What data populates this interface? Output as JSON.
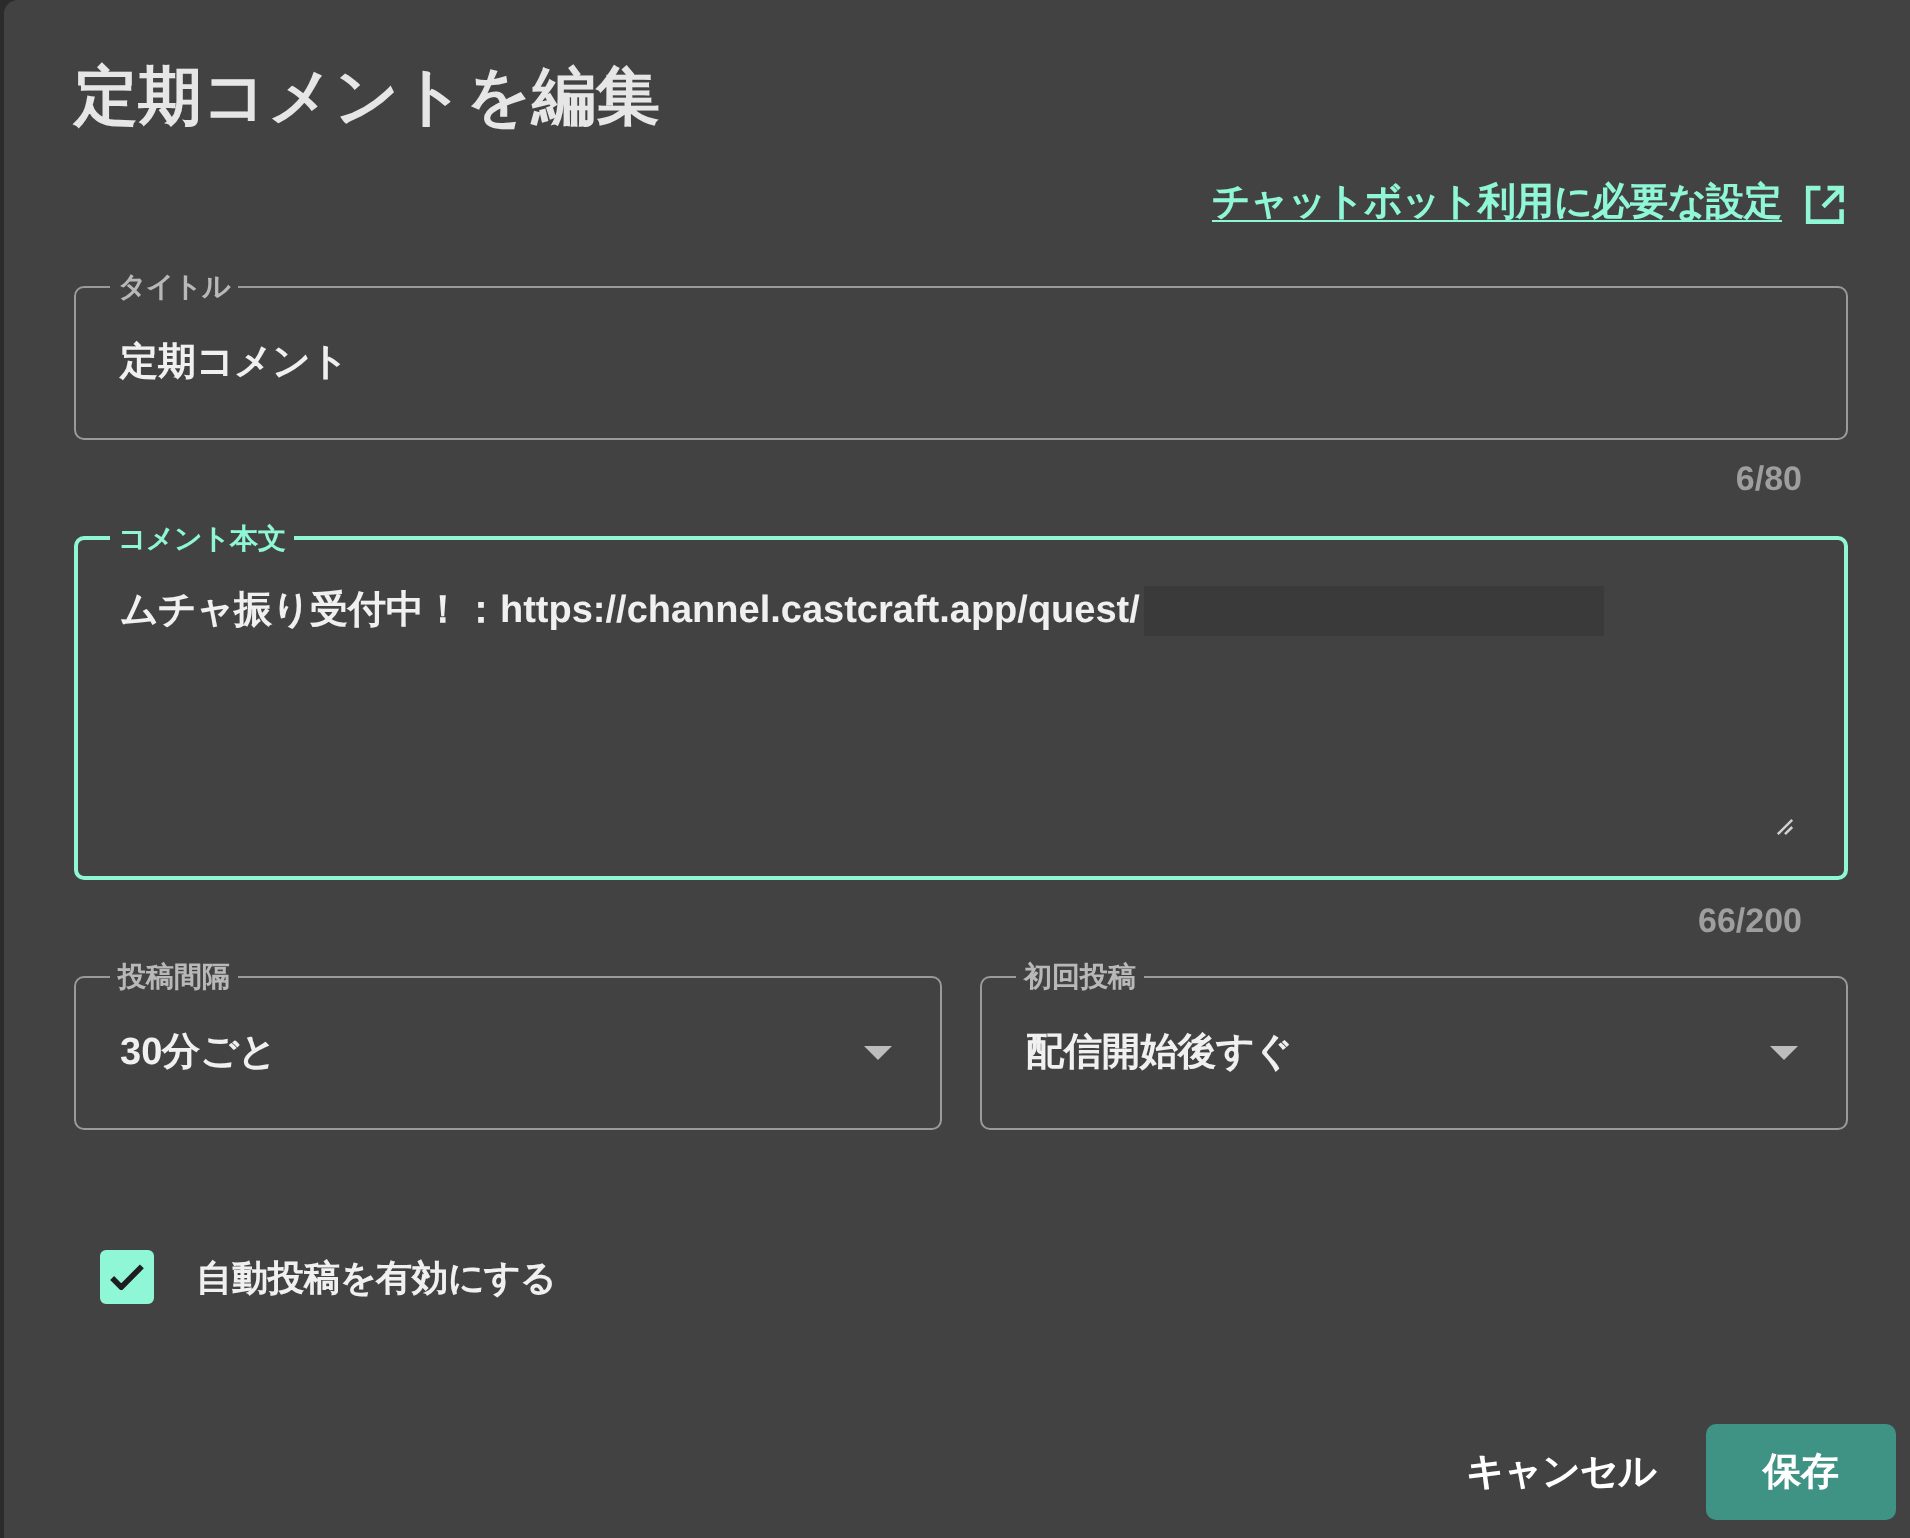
{
  "dialog": {
    "title": "定期コメントを編集",
    "help_link": {
      "label": "チャットボット利用に必要な設定"
    },
    "fields": [
      {
        "kind": "text",
        "label": "タイトル",
        "value": "定期コメント",
        "counter": "6/80",
        "focused": false
      },
      {
        "kind": "textarea",
        "label": "コメント本文",
        "value": "ムチャ振り受付中！：https://channel.castcraft.app/quest/",
        "counter": "66/200",
        "focused": true,
        "redacted": true
      }
    ],
    "selects": [
      {
        "label": "投稿間隔",
        "value": "30分ごと"
      },
      {
        "label": "初回投稿",
        "value": "配信開始後すぐ"
      }
    ],
    "auto_post": {
      "label": "自動投稿を有効にする",
      "checked": true
    },
    "buttons": [
      {
        "kind": "text",
        "label": "キャンセル"
      },
      {
        "kind": "primary",
        "label": "保存"
      }
    ]
  }
}
